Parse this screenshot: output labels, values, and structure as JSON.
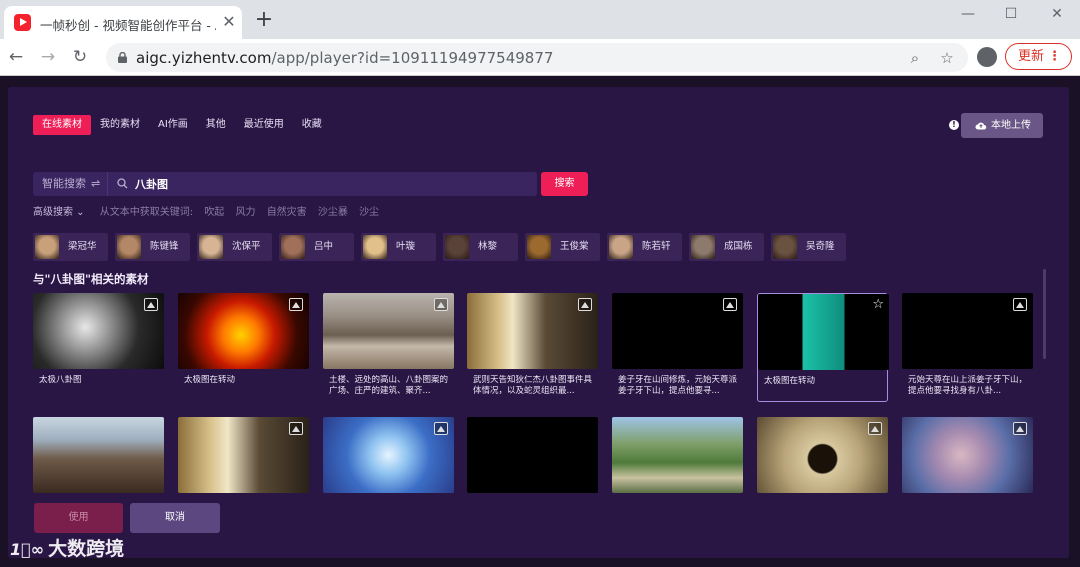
{
  "browser": {
    "tab_title": "一帧秒创 - 视频智能创作平台 - A",
    "close_glyph": "✕",
    "newtab_glyph": "+",
    "url_host": "aigc.yizhentv.com",
    "url_path": "/app/player?id=10911194977549877",
    "update_label": "更新",
    "window_controls": [
      "—",
      "☐",
      "✕"
    ]
  },
  "filters": {
    "tabs": [
      "在线素材",
      "我的素材",
      "AI作画",
      "其他",
      "最近使用",
      "收藏"
    ],
    "active": "在线素材"
  },
  "upload": {
    "label": "本地上传",
    "help_glyph": "!"
  },
  "search": {
    "mode_label": "智能搜索",
    "mode_swap_glyph": "⇌",
    "query": "八卦图",
    "button_label": "搜索"
  },
  "advanced": {
    "label": "高级搜索 ⌄",
    "hint": "从文本中获取关键词:",
    "keywords": [
      "吹起",
      "风力",
      "自然灾害",
      "沙尘暴",
      "沙尘"
    ]
  },
  "people": [
    {
      "name": "梁冠华",
      "color": "#c8a07a"
    },
    {
      "name": "陈键锋",
      "color": "#b48866"
    },
    {
      "name": "沈保平",
      "color": "#d6b494"
    },
    {
      "name": "吕中",
      "color": "#a0705a"
    },
    {
      "name": "叶璇",
      "color": "#e2c08a"
    },
    {
      "name": "林黎",
      "color": "#5a4238"
    },
    {
      "name": "王俊棠",
      "color": "#9c6a2e"
    },
    {
      "name": "陈若轩",
      "color": "#c9a486"
    },
    {
      "name": "成国栋",
      "color": "#8e7a6c"
    },
    {
      "name": "吴奇隆",
      "color": "#6a5240"
    }
  ],
  "results_title": "与\"八卦图\"相关的素材",
  "cards": [
    {
      "caption": "太极八卦图",
      "bg": "radial-gradient(circle at 40% 45%, #e8e8e8 0%, #8a8a8a 30%, #2a2a2a 60%, #0c0c0c 100%)",
      "badge": "ai",
      "selected": false
    },
    {
      "caption": "太极图在转动",
      "bg": "radial-gradient(circle at 48% 55%, #ffd200 0%, #ff7a00 22%, #c81a00 42%, #3a0800 70%, #100200 100%)",
      "badge": "ai",
      "selected": false
    },
    {
      "caption": "土楼、远处的高山、八卦图案的广场、庄严的建筑、聚齐...",
      "bg": "linear-gradient(180deg, #b9b4ae 0%, #9a8f84 30%, #6c5f52 55%, #c4b9aa 70%, #877562 100%)",
      "badge": "ai",
      "selected": false
    },
    {
      "caption": "武则天告知狄仁杰八卦图事件具体情况，以及蛇灵组织最...",
      "bg": "linear-gradient(90deg, #8a6e3a 0%, #d9c28c 25%, #f0e6c6 35%, #5a4a36 60%, #2a2218 100%)",
      "badge": "ai",
      "selected": false
    },
    {
      "caption": "姜子牙在山间修炼，元始天尊派姜子牙下山，提点他要寻...",
      "bg": "#000000",
      "badge": "ai",
      "selected": false
    },
    {
      "caption": "太极图在转动",
      "bg": "linear-gradient(90deg, #000 0%, #000 34%, #1bc2a8 34%, #0e8e7c 66%, #000 66%, #000 100%)",
      "badge": "star",
      "selected": true
    },
    {
      "caption": "元始天尊在山上派姜子牙下山，提点他要寻找身有八卦...",
      "bg": "#000000",
      "badge": "ai",
      "selected": false
    },
    {
      "caption": "",
      "bg": "linear-gradient(180deg, #c9d6e2 0%, #9eaebd 30%, #6e5a48 55%, #3a2a20 100%)",
      "badge": "none",
      "selected": false
    },
    {
      "caption": "",
      "bg": "linear-gradient(90deg, #8a6e3a 0%, #d9c28c 25%, #f0e6c6 38%, #5a4a36 62%, #2a2218 100%)",
      "badge": "ai",
      "selected": false
    },
    {
      "caption": "",
      "bg": "radial-gradient(circle at 50% 50%, #e6f4ff 0%, #8fc3f0 25%, #3b6ec6 55%, #2a3c8a 100%)",
      "badge": "ai",
      "selected": false
    },
    {
      "caption": "",
      "bg": "#000000",
      "badge": "none",
      "selected": false
    },
    {
      "caption": "",
      "bg": "linear-gradient(180deg, #9ec3e6 0%, #7fa06a 35%, #4e7a3a 60%, #c9c2a0 80%, #5a6e44 100%)",
      "badge": "none",
      "selected": false
    },
    {
      "caption": "",
      "bg": "radial-gradient(circle at 50% 55%, #1a1208 0%, #1a1208 18%, #d8c8a0 20%, #b8a478 50%, #5a4a30 100%)",
      "badge": "ai",
      "selected": false
    },
    {
      "caption": "",
      "bg": "radial-gradient(circle at 45% 50%, #d9b8c2 0%, #a58ab0 30%, #5a6ea8 60%, #2a2a58 100%)",
      "badge": "ai",
      "selected": false
    }
  ],
  "actions": {
    "use_label": "使用",
    "cancel_label": "取消"
  },
  "watermark": {
    "logo": "1⃝∞",
    "text": "大数跨境"
  },
  "colors": {
    "accent": "#ee1f57",
    "modal_bg": "#2a1645",
    "page_bg": "#1b1126"
  }
}
